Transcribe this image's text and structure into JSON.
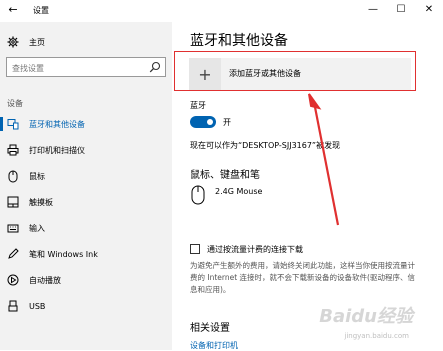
{
  "window": {
    "title": "设置",
    "back_glyph": "←",
    "minimize_glyph": "—",
    "maximize_glyph": "☐",
    "close_glyph": "✕"
  },
  "sidebar": {
    "home_label": "主页",
    "search_placeholder": "查找设置",
    "section_label": "设备",
    "items": [
      {
        "label": "蓝牙和其他设备",
        "icon": "bluetooth-devices-icon",
        "active": true
      },
      {
        "label": "打印机和扫描仪",
        "icon": "printer-icon",
        "active": false
      },
      {
        "label": "鼠标",
        "icon": "mouse-icon",
        "active": false
      },
      {
        "label": "触摸板",
        "icon": "touchpad-icon",
        "active": false
      },
      {
        "label": "输入",
        "icon": "keyboard-icon",
        "active": false
      },
      {
        "label": "笔和 Windows Ink",
        "icon": "pen-icon",
        "active": false
      },
      {
        "label": "自动播放",
        "icon": "autoplay-icon",
        "active": false
      },
      {
        "label": "USB",
        "icon": "usb-icon",
        "active": false
      }
    ]
  },
  "main": {
    "heading": "蓝牙和其他设备",
    "add_device_label": "添加蓝牙或其他设备",
    "bluetooth_label": "蓝牙",
    "toggle_state": "开",
    "discoverable_text": "现在可以作为“DESKTOP-SJJ3167”被发现",
    "mouse_section_title": "鼠标、键盘和笔",
    "device_name": "2.4G Mouse",
    "metered_label": "通过按流量计费的连接下载",
    "metered_desc": "为避免产生额外的费用，请始终关闭此功能，这样当你使用按流量计费的 Internet 连接时，就不会下载新设备的设备软件(驱动程序、信息和应用)。",
    "related_title": "相关设置",
    "related_link": "设备和打印机"
  },
  "watermark": {
    "text": "Baidu经验",
    "url": "jingyan.baidu.com"
  },
  "colors": {
    "accent": "#0063b1",
    "annotation": "#e03030",
    "sidebar_bg": "#f2f2f2"
  }
}
